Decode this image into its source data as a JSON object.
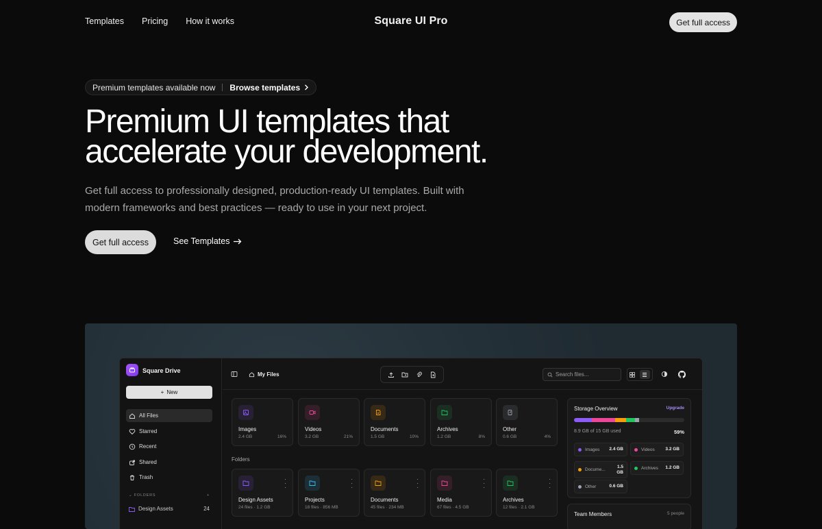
{
  "nav": {
    "links": [
      "Templates",
      "Pricing",
      "How it works"
    ],
    "brand": "Square UI Pro",
    "cta": "Get full access"
  },
  "hero": {
    "pill_text": "Premium templates available now",
    "pill_link": "Browse templates",
    "title_line1": "Premium UI templates that",
    "title_line2": "accelerate your development.",
    "subtitle": "Get full access to professionally designed, production-ready UI templates. Built with modern frameworks and best practices — ready to use in your next project.",
    "primary_button": "Get full access",
    "secondary_button": "See Templates"
  },
  "app": {
    "name": "Square Drive",
    "new_button": "New",
    "sidebar": [
      {
        "label": "All Files",
        "icon": "home-icon"
      },
      {
        "label": "Starred",
        "icon": "heart-icon"
      },
      {
        "label": "Recent",
        "icon": "clock-icon"
      },
      {
        "label": "Shared",
        "icon": "share-icon"
      },
      {
        "label": "Trash",
        "icon": "trash-icon"
      }
    ],
    "folders_heading": "FOLDERS",
    "folders_add": "+",
    "sidebar_folder": {
      "label": "Design Assets",
      "count": "24"
    },
    "breadcrumb": "My Files",
    "search_placeholder": "Search files...",
    "categories": [
      {
        "name": "Images",
        "size": "2.4 GB",
        "pct": "16%",
        "color": "#8b5cf6"
      },
      {
        "name": "Videos",
        "size": "3.2 GB",
        "pct": "21%",
        "color": "#ec4899"
      },
      {
        "name": "Documents",
        "size": "1.5 GB",
        "pct": "10%",
        "color": "#f59e0b"
      },
      {
        "name": "Archives",
        "size": "1.2 GB",
        "pct": "8%",
        "color": "#22c55e"
      },
      {
        "name": "Other",
        "size": "0.6 GB",
        "pct": "4%",
        "color": "#9ca3af"
      }
    ],
    "folders_section": "Folders",
    "folders": [
      {
        "name": "Design Assets",
        "meta": "24 files · 1.2 GB",
        "color": "#8b5cf6"
      },
      {
        "name": "Projects",
        "meta": "18 files · 856 MB",
        "color": "#38bdf8"
      },
      {
        "name": "Documents",
        "meta": "45 files · 234 MB",
        "color": "#f59e0b"
      },
      {
        "name": "Media",
        "meta": "67 files · 4.5 GB",
        "color": "#ec4899"
      },
      {
        "name": "Archives",
        "meta": "12 files · 2.1 GB",
        "color": "#22c55e"
      }
    ],
    "storage": {
      "title": "Storage Overview",
      "upgrade": "Upgrade",
      "used_text": "8.9 GB of 15 GB used",
      "used_pct": "59%",
      "used_fraction": 0.59,
      "legend": [
        {
          "label": "Images",
          "value": "2.4 GB",
          "color": "#8b5cf6",
          "share": 2.4
        },
        {
          "label": "Videos",
          "value": "3.2 GB",
          "color": "#ec4899",
          "share": 3.2
        },
        {
          "label": "Docume...",
          "value": "1.5 GB",
          "color": "#f59e0b",
          "share": 1.5
        },
        {
          "label": "Archives",
          "value": "1.2 GB",
          "color": "#22c55e",
          "share": 1.2
        },
        {
          "label": "Other",
          "value": "0.6 GB",
          "color": "#9ca3af",
          "share": 0.6
        }
      ]
    },
    "team": {
      "title": "Team Members",
      "count": "5 people"
    }
  }
}
